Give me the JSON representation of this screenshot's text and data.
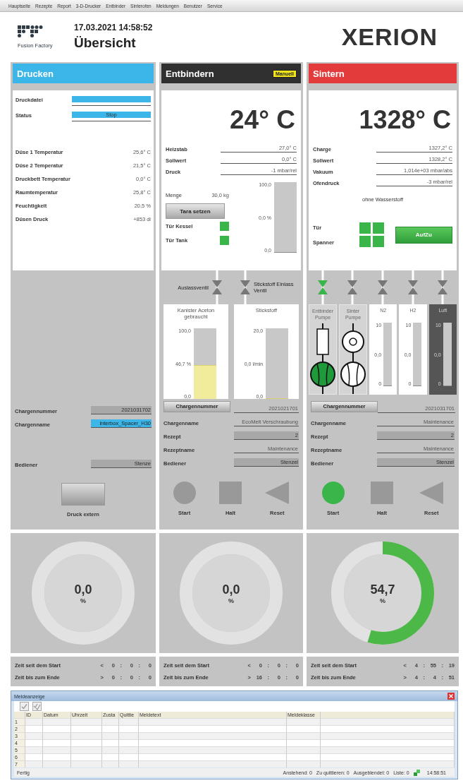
{
  "menu": [
    "Hauptseite",
    "Rezepte",
    "Report",
    "3-D-Drucker",
    "Entbinder",
    "Sinterofen",
    "Meldungen",
    "Benutzer",
    "Service"
  ],
  "header": {
    "logo_caption": "Fusion Factory",
    "datetime": "17.03.2021 14:58:52",
    "title": "Übersicht",
    "brand": "XERION"
  },
  "printer": {
    "title": "Drucken",
    "file_label": "Druckdatei",
    "status_label": "Status",
    "status": "Stop",
    "readings": [
      {
        "label": "Düse 1 Temperatur",
        "value": "25,6° C"
      },
      {
        "label": "Düse 2 Temperatur",
        "value": "21,5° C"
      },
      {
        "label": "Druckbett Temperatur",
        "value": "0,0° C"
      },
      {
        "label": "Raumtemperatur",
        "value": "25,8° C"
      },
      {
        "label": "Feuchtigkeit",
        "value": "20,5 %"
      },
      {
        "label": "Düsen Druck",
        "value": "+853 di"
      }
    ],
    "batch": [
      {
        "label": "Chargennummer",
        "value": "2021031702",
        "kind": "grey"
      },
      {
        "label": "Chargenname",
        "value": "interbox_Spacer_H30",
        "kind": "highlight"
      },
      {
        "label": "Bediener",
        "value": "Stenze",
        "kind": "grey"
      }
    ],
    "button": "Druck extern"
  },
  "debinding": {
    "title": "Entbindern",
    "mode": "Manuell",
    "temperature": "24° C",
    "readings": [
      {
        "label": "Heizstab",
        "value": "27,0° C"
      },
      {
        "label": "Sollwert",
        "value": "0,0° C"
      },
      {
        "label": "Druck",
        "value": "-1 mbar/rel"
      }
    ],
    "scale": {
      "label": "Menge",
      "value": "30,0 kg",
      "max": "100,0",
      "reading": "0,0 %",
      "min": "0,0",
      "level": 0
    },
    "tare_button": "Tara setzen",
    "doors": [
      {
        "label": "Tür Kessel",
        "closed": true
      },
      {
        "label": "Tür Tank",
        "closed": true
      }
    ],
    "valves": [
      {
        "label": "Auslassventil",
        "open": false
      },
      {
        "label": "Stickstoff Einlass Ventil",
        "open": false
      }
    ],
    "tanks": [
      {
        "title": "Kanister Aceton gebraucht",
        "max": "100,0",
        "reading": "46,7 %",
        "min": "0,0",
        "level": 0.467
      },
      {
        "title": "Stickstoff",
        "max": "20,0",
        "reading": "0,0 l/min",
        "min": "0,0",
        "level": 0
      }
    ],
    "batch": [
      {
        "label": "Chargennummer",
        "value": "2021021701",
        "kind": "button"
      },
      {
        "label": "Chargenname",
        "value": "EcoMelt Verschraubung",
        "kind": "plain"
      },
      {
        "label": "Rezept",
        "value": "2",
        "kind": "grey"
      },
      {
        "label": "Rezeptname",
        "value": "Maintenance",
        "kind": "plain"
      },
      {
        "label": "Bediener",
        "value": "Stenzel",
        "kind": "grey"
      }
    ],
    "controls": [
      {
        "kind": "start",
        "label": "Start",
        "active": false
      },
      {
        "kind": "stop",
        "label": "Halt",
        "active": false
      },
      {
        "kind": "reset",
        "label": "Reset",
        "active": false
      }
    ]
  },
  "sintering": {
    "title": "Sintern",
    "temperature": "1328° C",
    "readings": [
      {
        "label": "Charge",
        "value": "1327,2° C"
      },
      {
        "label": "Sollwert",
        "value": "1328,2° C"
      },
      {
        "label": "Vakuum",
        "value": "1,014e+03 mbar/abs"
      },
      {
        "label": "Ofendruck",
        "value": "-3 mbar/rel"
      }
    ],
    "note": "ohne Wasserstoff",
    "door_labels": [
      "Tür",
      "Spanner"
    ],
    "door_indicators": [
      {
        "closed": true
      },
      {
        "closed": true
      },
      {
        "closed": true
      },
      {
        "closed": true
      }
    ],
    "door_button": "AufZu",
    "valves": [
      {
        "open": true
      },
      {
        "open": false
      },
      {
        "open": false
      },
      {
        "open": false
      },
      {
        "open": false
      }
    ],
    "units": [
      {
        "kind": "filter_pump",
        "title": "Entbinder Pumpe",
        "on": true
      },
      {
        "kind": "vacuum_pump",
        "title": "Sinter Pumpe",
        "on": false
      },
      {
        "kind": "meter",
        "title": "N2",
        "max": "10",
        "reading": "0,0",
        "min": "0",
        "level": 0,
        "disabled": false
      },
      {
        "kind": "meter",
        "title": "H2",
        "max": "10",
        "reading": "0,0",
        "min": "0",
        "level": 0,
        "disabled": false
      },
      {
        "kind": "meter",
        "title": "Luft",
        "max": "10",
        "reading": "0,0",
        "min": "0",
        "level": 0,
        "disabled": true
      }
    ],
    "batch": [
      {
        "label": "Chargennummer",
        "value": "2021031701",
        "kind": "button"
      },
      {
        "label": "Chargenname",
        "value": "Maintenance",
        "kind": "plain"
      },
      {
        "label": "Rezept",
        "value": "2",
        "kind": "grey"
      },
      {
        "label": "Rezeptname",
        "value": "Maintenance",
        "kind": "plain"
      },
      {
        "label": "Bediener",
        "value": "Stenzel",
        "kind": "grey"
      }
    ],
    "controls": [
      {
        "kind": "start",
        "label": "Start",
        "active": true
      },
      {
        "kind": "stop",
        "label": "Halt",
        "active": false
      },
      {
        "kind": "reset",
        "label": "Reset",
        "active": false
      }
    ]
  },
  "gauges": [
    {
      "value": "0,0",
      "unit": "%"
    },
    {
      "value": "0,0",
      "unit": "%"
    },
    {
      "value": "54,7",
      "unit": "%"
    }
  ],
  "timers": [
    [
      {
        "label": "Zeit seit dem Start",
        "parts": [
          "<",
          "0",
          ":",
          "0",
          ":",
          "0"
        ]
      },
      {
        "label": "Zeit bis zum Ende",
        "parts": [
          ">",
          "0",
          ":",
          "0",
          ":",
          "0"
        ]
      }
    ],
    [
      {
        "label": "Zeit seit dem Start",
        "parts": [
          "<",
          "0",
          ":",
          "0",
          ":",
          "0"
        ]
      },
      {
        "label": "Zeit bis zum Ende",
        "parts": [
          ">",
          "16",
          ":",
          "0",
          ":",
          "0"
        ]
      }
    ],
    [
      {
        "label": "Zeit seit dem Start",
        "parts": [
          "<",
          "4",
          ":",
          "55",
          ":",
          "19"
        ]
      },
      {
        "label": "Zeit bis zum Ende",
        "parts": [
          ">",
          "4",
          ":",
          "4",
          ":",
          "51"
        ]
      }
    ]
  ],
  "messages": {
    "title": "Meldeanzeige",
    "columns": [
      "ID",
      "Datum",
      "Uhrzeit",
      "Zusta",
      "Quittie",
      "Meldetext",
      "Meldeklasse"
    ],
    "rows": [
      "1",
      "2",
      "3",
      "4",
      "5",
      "6",
      "7"
    ],
    "status": "Fertig",
    "counters": [
      "Anstehend: 0",
      "Zu quittieren: 0",
      "Ausgeblendet: 0",
      "Liste: 0"
    ],
    "time": "14:58:51"
  }
}
